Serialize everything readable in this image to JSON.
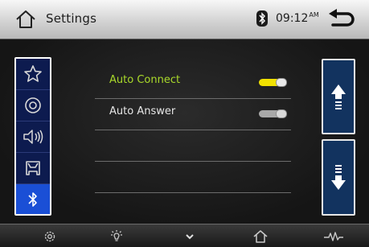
{
  "header": {
    "title": "Settings",
    "time": "09:12",
    "ampm": "AM",
    "icons": {
      "home": "home-icon",
      "bluetooth": "bluetooth-status-icon",
      "back": "back-icon"
    }
  },
  "sidebar": {
    "items": [
      {
        "id": "favorites",
        "icon": "star-icon",
        "active": false
      },
      {
        "id": "media",
        "icon": "disc-icon",
        "active": false
      },
      {
        "id": "audio",
        "icon": "speaker-icon",
        "active": false
      },
      {
        "id": "vehicle",
        "icon": "car-icon",
        "active": false
      },
      {
        "id": "bluetooth",
        "icon": "bluetooth-icon",
        "active": true
      }
    ]
  },
  "settings": {
    "rows": [
      {
        "label": "Auto Connect",
        "state": "on"
      },
      {
        "label": "Auto Answer",
        "state": "off"
      },
      {
        "label": "",
        "state": null
      },
      {
        "label": "",
        "state": null
      },
      {
        "label": "",
        "state": null
      }
    ]
  },
  "scroll": {
    "up_icon": "arrow-up-icon",
    "down_icon": "arrow-down-icon"
  },
  "bottom_bar": {
    "items": [
      "settings-gear-icon",
      "brightness-icon",
      "chevron-down-icon",
      "home-icon",
      "audio-eq-icon"
    ]
  },
  "colors": {
    "accent_green": "#a9d92a",
    "toggle_on": "#f0e000",
    "sidebar_active": "#1a4fd6",
    "panel_blue": "#0d1b4f"
  }
}
